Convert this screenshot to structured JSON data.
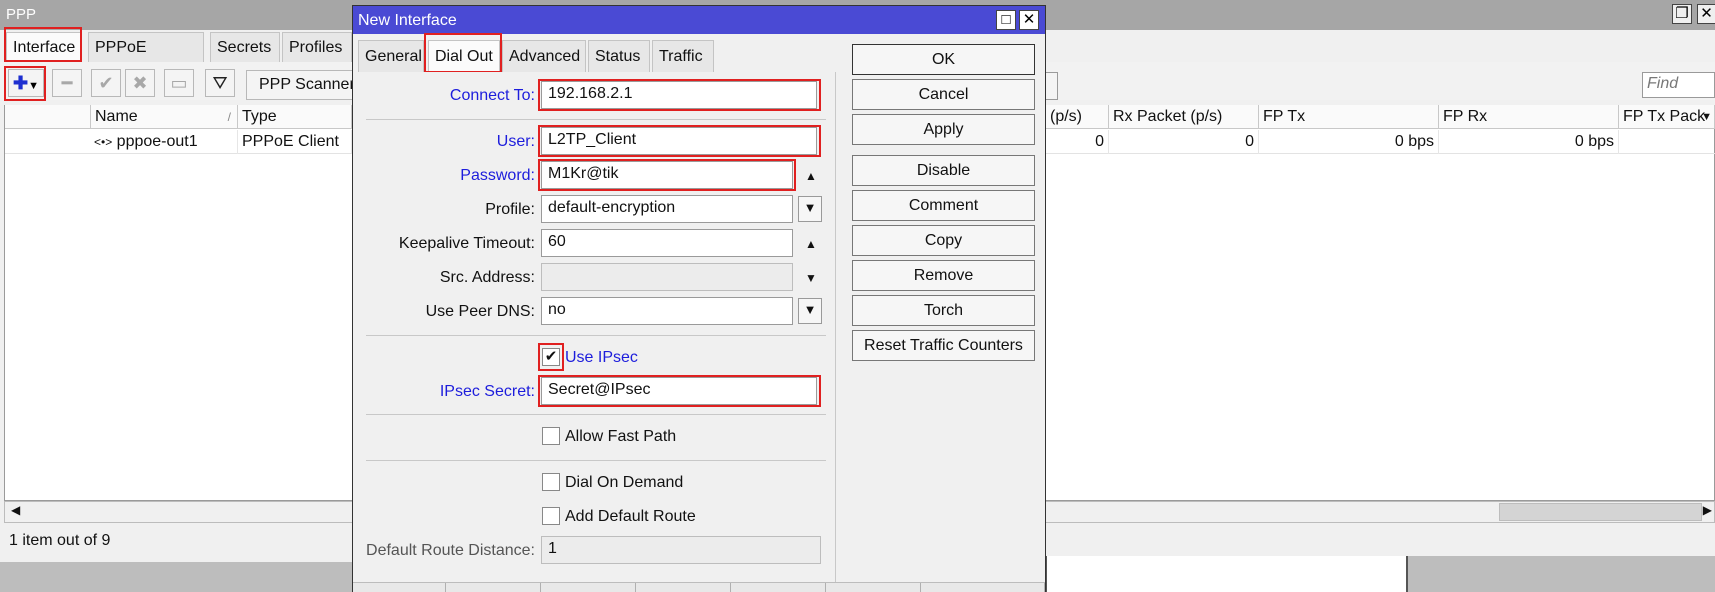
{
  "ppp": {
    "title": "PPP",
    "close_glyph": "✕",
    "restore_glyph": "❐",
    "tabs": [
      "Interface",
      "PPPoE Servers",
      "Secrets",
      "Profiles"
    ],
    "scanner_label": "PPP Scanner",
    "find_placeholder": "Find",
    "columns": [
      "Name",
      "Type",
      "(p/s)",
      "Rx Packet (p/s)",
      "FP Tx",
      "FP Rx",
      "FP Tx Pack"
    ],
    "row": {
      "name": "pppoe-out1",
      "type": "PPPoE Client",
      "tx_pps": "0",
      "rx_pps": "0",
      "fp_tx": "0 bps",
      "fp_rx": "0 bps"
    },
    "status": "1 item out of 9"
  },
  "dialog": {
    "title": "New Interface",
    "tabs": [
      "General",
      "Dial Out",
      "Advanced",
      "Status",
      "Traffic"
    ],
    "fields": {
      "connect_to_label": "Connect To:",
      "connect_to_value": "192.168.2.1",
      "user_label": "User:",
      "user_value": "L2TP_Client",
      "password_label": "Password:",
      "password_value": "M1Kr@tik",
      "profile_label": "Profile:",
      "profile_value": "default-encryption",
      "keepalive_label": "Keepalive Timeout:",
      "keepalive_value": "60",
      "src_address_label": "Src. Address:",
      "src_address_value": "",
      "use_peer_dns_label": "Use Peer DNS:",
      "use_peer_dns_value": "no",
      "use_ipsec_label": "Use IPsec",
      "use_ipsec_checked": true,
      "ipsec_secret_label": "IPsec Secret:",
      "ipsec_secret_value": "Secret@IPsec",
      "allow_fast_path_label": "Allow Fast Path",
      "dial_on_demand_label": "Dial On Demand",
      "add_default_route_label": "Add Default Route",
      "default_route_distance_label": "Default Route Distance:",
      "default_route_distance_value": "1"
    },
    "buttons": [
      "OK",
      "Cancel",
      "Apply",
      "Disable",
      "Comment",
      "Copy",
      "Remove",
      "Torch",
      "Reset Traffic Counters"
    ]
  },
  "colors": {
    "accent_title": "#4a4ad4",
    "label_blue": "#1d1ddc",
    "highlight_red": "#e02020"
  }
}
